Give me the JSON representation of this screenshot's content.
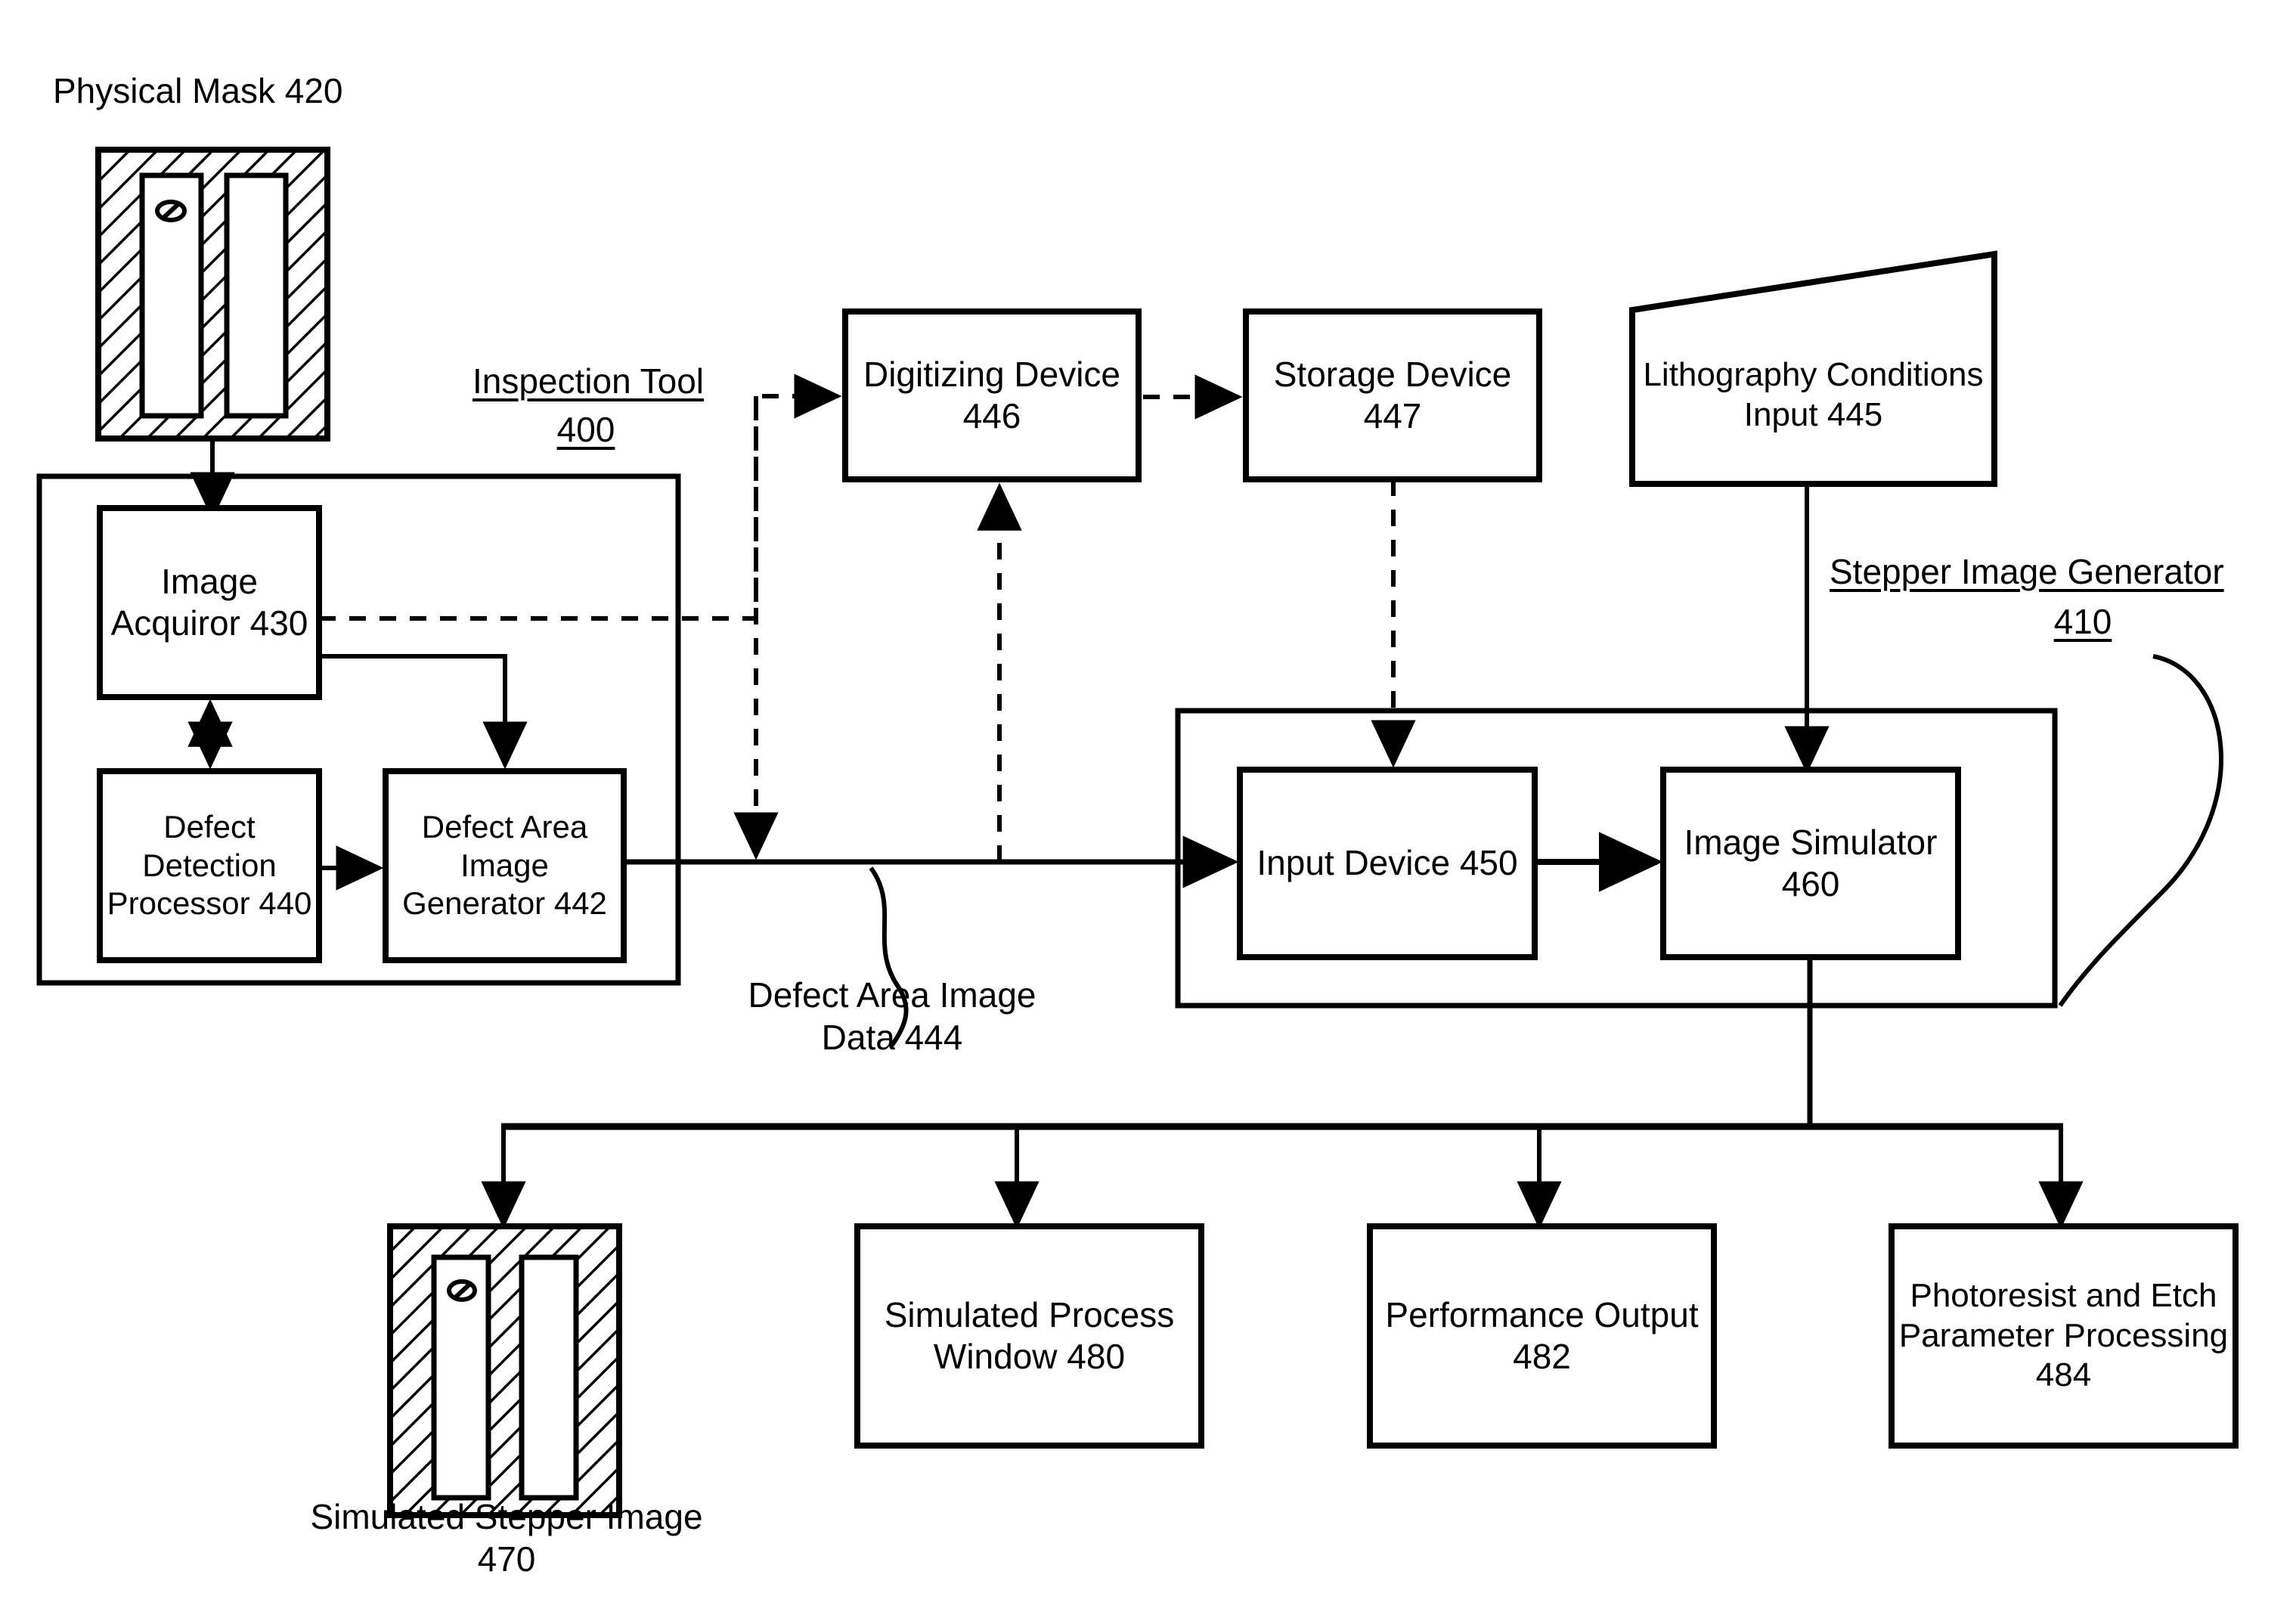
{
  "figure": {
    "title_ref": "Physical Mask 420",
    "blocks": [
      {
        "key": "physical_mask",
        "label": "Physical Mask 420",
        "ref": "420"
      },
      {
        "key": "inspection_tool",
        "label": "Inspection Tool",
        "ref": "400"
      },
      {
        "key": "image_acquiror",
        "label": "Image\nAcquiror",
        "ref": "430"
      },
      {
        "key": "defect_detection",
        "label": "Defect\nDetection\nProcessor",
        "ref": "440"
      },
      {
        "key": "defect_area_gen",
        "label": "Defect Area\nImage\nGenerator",
        "ref": "442"
      },
      {
        "key": "digitizing_device",
        "label": "Digitizing\nDevice",
        "ref": "446"
      },
      {
        "key": "storage_device",
        "label": "Storage\nDevice",
        "ref": "447"
      },
      {
        "key": "litho_conditions",
        "label": "Lithography\nConditions\nInput",
        "ref": "445"
      },
      {
        "key": "stepper_image_gen",
        "label": "Stepper Image Generator",
        "ref": "410"
      },
      {
        "key": "input_device",
        "label": "Input Device",
        "ref": "450"
      },
      {
        "key": "image_simulator",
        "label": "Image\nSimulator",
        "ref": "460"
      },
      {
        "key": "defect_area_data",
        "label": "Defect Area Image\nData 444",
        "ref": "444"
      },
      {
        "key": "simulated_stepper",
        "label": "Simulated Stepper Image",
        "ref": "470"
      },
      {
        "key": "sim_process_window",
        "label": "Simulated\nProcess Window",
        "ref": "480"
      },
      {
        "key": "performance_output",
        "label": "Performance\nOutput",
        "ref": "482"
      },
      {
        "key": "photoresist_etch",
        "label": "Photoresist and\nEtch Parameter\nProcessing",
        "ref": "484"
      }
    ],
    "labels": {
      "physical_mask": "Physical Mask 420",
      "inspection_tool_name": "Inspection Tool",
      "inspection_tool_ref": "400",
      "image_acquiror": "Image\nAcquiror\n430",
      "defect_detection_processor": "Defect\nDetection\nProcessor\n440",
      "defect_area_image_generator": "Defect Area\nImage\nGenerator\n442",
      "digitizing_device": "Digitizing\nDevice\n446",
      "storage_device": "Storage\nDevice\n447",
      "lithography_conditions_input": "Lithography\nConditions\nInput\n445",
      "stepper_image_generator_name": "Stepper Image Generator",
      "stepper_image_generator_ref": "410",
      "input_device": "Input Device\n450",
      "image_simulator": "Image\nSimulator\n460",
      "defect_area_image_data": "Defect Area Image\nData 444",
      "simulated_stepper_image": "Simulated Stepper Image\n470",
      "simulated_process_window": "Simulated\nProcess Window\n480",
      "performance_output": "Performance\nOutput\n482",
      "photoresist_and_etch": "Photoresist and\nEtch Parameter\nProcessing\n484"
    },
    "colors": {
      "ink": "#000000",
      "paper": "#ffffff"
    },
    "line_styles": {
      "solid": "solid",
      "dashed": "dashed"
    },
    "connections": [
      {
        "from": "physical_mask",
        "to": "image_acquiror",
        "style": "solid",
        "arrow": "single"
      },
      {
        "from": "image_acquiror",
        "to": "defect_detection",
        "style": "solid",
        "arrow": "double"
      },
      {
        "from": "defect_detection",
        "to": "defect_area_gen",
        "style": "solid",
        "arrow": "single"
      },
      {
        "from": "image_acquiror",
        "to": "defect_area_gen",
        "style": "solid",
        "arrow": "single"
      },
      {
        "from": "image_acquiror",
        "to": "digitizing_device",
        "style": "dashed",
        "arrow": "single"
      },
      {
        "from": "digitizing_device",
        "to": "storage_device",
        "style": "dashed",
        "arrow": "single"
      },
      {
        "from": "storage_device",
        "to": "input_device",
        "style": "dashed",
        "arrow": "single"
      },
      {
        "from": "image_acquiror",
        "to": "defect_area_data",
        "style": "dashed",
        "arrow": "single"
      },
      {
        "from": "defect_area_data",
        "to": "digitizing_device",
        "style": "dashed",
        "arrow": "single"
      },
      {
        "from": "defect_area_gen",
        "to": "input_device",
        "style": "solid",
        "arrow": "single"
      },
      {
        "from": "litho_conditions",
        "to": "image_simulator",
        "style": "solid",
        "arrow": "single"
      },
      {
        "from": "input_device",
        "to": "image_simulator",
        "style": "solid",
        "arrow": "single"
      },
      {
        "from": "image_simulator",
        "to": "simulated_stepper",
        "style": "solid",
        "arrow": "single"
      },
      {
        "from": "image_simulator",
        "to": "sim_process_window",
        "style": "solid",
        "arrow": "single"
      },
      {
        "from": "image_simulator",
        "to": "performance_output",
        "style": "solid",
        "arrow": "single"
      },
      {
        "from": "image_simulator",
        "to": "photoresist_etch",
        "style": "solid",
        "arrow": "single"
      }
    ]
  }
}
